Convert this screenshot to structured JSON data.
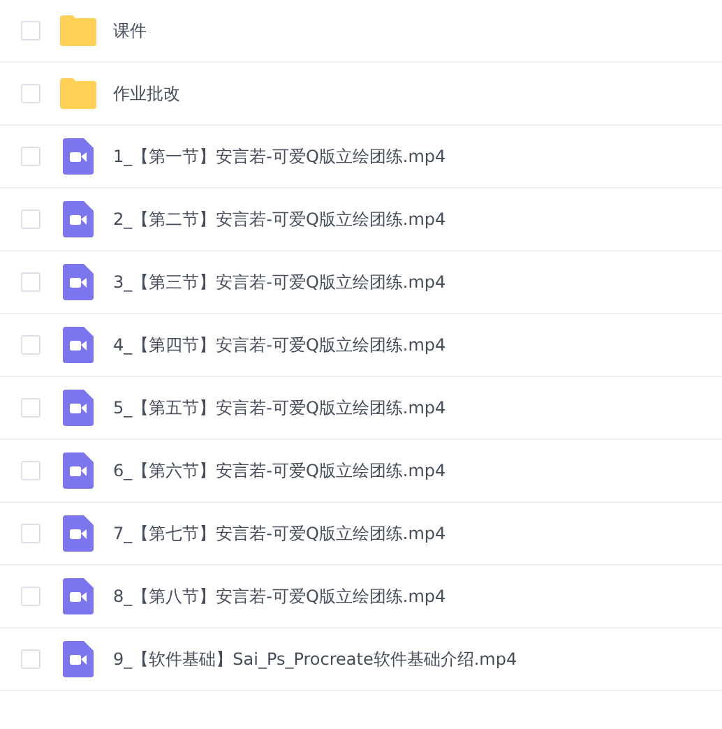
{
  "files": [
    {
      "kind": "folder",
      "name": "课件",
      "checked": false
    },
    {
      "kind": "folder",
      "name": "作业批改",
      "checked": false
    },
    {
      "kind": "video",
      "name": "1_【第一节】安言若-可爱Q版立绘团练.mp4",
      "checked": false
    },
    {
      "kind": "video",
      "name": "2_【第二节】安言若-可爱Q版立绘团练.mp4",
      "checked": false
    },
    {
      "kind": "video",
      "name": "3_【第三节】安言若-可爱Q版立绘团练.mp4",
      "checked": false
    },
    {
      "kind": "video",
      "name": "4_【第四节】安言若-可爱Q版立绘团练.mp4",
      "checked": false
    },
    {
      "kind": "video",
      "name": "5_【第五节】安言若-可爱Q版立绘团练.mp4",
      "checked": false
    },
    {
      "kind": "video",
      "name": "6_【第六节】安言若-可爱Q版立绘团练.mp4",
      "checked": false
    },
    {
      "kind": "video",
      "name": "7_【第七节】安言若-可爱Q版立绘团练.mp4",
      "checked": false
    },
    {
      "kind": "video",
      "name": "8_【第八节】安言若-可爱Q版立绘团练.mp4",
      "checked": false
    },
    {
      "kind": "video",
      "name": "9_【软件基础】Sai_Ps_Procreate软件基础介绍.mp4",
      "checked": false
    }
  ]
}
